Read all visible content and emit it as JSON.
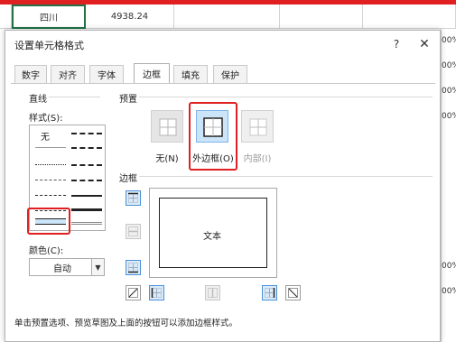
{
  "sheet": {
    "row": {
      "province": "四川",
      "value": "4938.24"
    },
    "right_values": [
      "00%",
      "00%",
      "00%",
      "00%",
      "00%",
      "00%"
    ]
  },
  "dialog": {
    "title": "设置单元格格式",
    "help_label": "?",
    "close_label": "✕",
    "tabs": [
      "数字",
      "对齐",
      "字体",
      "边框",
      "填充",
      "保护"
    ],
    "active_tab": "边框"
  },
  "line": {
    "group_label": "直线",
    "style_label": "样式(S):",
    "none_label": "无",
    "color_label": "颜色(C):",
    "color_value": "自动"
  },
  "preset": {
    "group_label": "预置",
    "items": [
      {
        "label": "无(N)",
        "state": "normal"
      },
      {
        "label": "外边框(O)",
        "state": "selected"
      },
      {
        "label": "内部(I)",
        "state": "disabled"
      }
    ]
  },
  "border": {
    "group_label": "边框",
    "preview_text": "文本"
  },
  "hint": "单击预置选项、预览草图及上面的按钮可以添加边框样式。",
  "colors": {
    "highlight": "#e02020",
    "accent": "#217346",
    "selected": "#cce4f7"
  }
}
